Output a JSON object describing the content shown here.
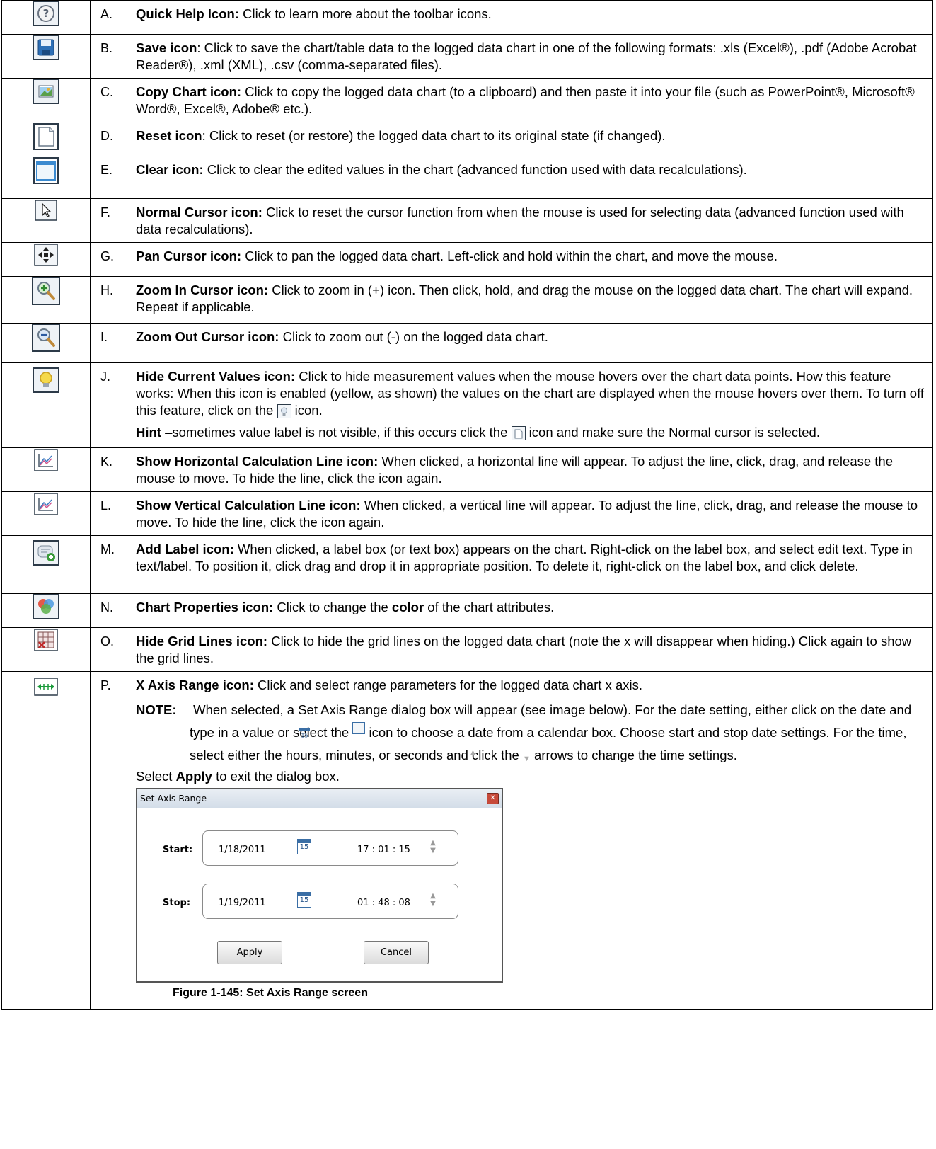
{
  "rows": [
    {
      "letter": "A.",
      "label": "Quick Help Icon:",
      "text": " Click to learn more about the toolbar icons.",
      "icon": "question-circle-icon"
    },
    {
      "letter": "B.",
      "label": "Save icon",
      "text": ": Click to save the chart/table data to the logged data chart in one of the following formats: .xls (Excel®), .pdf (Adobe Acrobat Reader®), .xml (XML), .csv (comma-separated files).",
      "icon": "floppy-save-icon"
    },
    {
      "letter": "C.",
      "label": "Copy Chart icon:",
      "text": " Click to copy the logged data chart (to a clipboard) and then paste it into your file (such as PowerPoint®, Microsoft® Word®, Excel®, Adobe® etc.).",
      "icon": "copy-chart-icon"
    },
    {
      "letter": "D.",
      "label": "Reset icon",
      "text": ": Click to reset (or restore) the logged data chart to its original state (if changed).",
      "icon": "blank-page-icon"
    },
    {
      "letter": "E.",
      "label": "Clear icon:",
      "text": " Click to clear the edited values in the chart (advanced function used with data recalculations).",
      "icon": "clear-window-icon"
    },
    {
      "letter": "F.",
      "label": "Normal Cursor icon:",
      "text": " Click to reset the cursor function from when the mouse is used for selecting data (advanced function used with data recalculations).",
      "icon": "arrow-cursor-icon"
    },
    {
      "letter": "G.",
      "label": "Pan Cursor icon:",
      "text": " Click to pan the logged data chart. Left-click and hold within the chart, and move the mouse.",
      "icon": "pan-arrows-icon"
    },
    {
      "letter": "H.",
      "label": "Zoom In Cursor icon:",
      "text": "  Click to zoom in (+) icon. Then click, hold, and drag the mouse on the logged data chart. The chart will expand. Repeat if applicable.",
      "icon": "zoom-in-icon"
    },
    {
      "letter": "I.",
      "label": "Zoom Out Cursor icon:",
      "text": " Click to zoom out (-) on the logged data chart.",
      "icon": "zoom-out-icon"
    },
    {
      "letter": "J.",
      "label": "Hide Current Values icon:",
      "text": " Click to hide measurement values when the mouse hovers over the chart data points. How this feature works: When this icon is enabled (yellow, as shown) the values on the chart are displayed when the mouse hovers over them. To turn off this feature, click on the",
      "text_after": " icon.",
      "hint_label": "Hint",
      "hint_text": " –sometimes value label is not visible, if this occurs click the",
      "hint_after": " icon and make sure the Normal cursor is selected.",
      "icon": "lightbulb-icon"
    },
    {
      "letter": "K.",
      "label": "Show Horizontal Calculation Line icon:",
      "text": " When clicked, a horizontal line will appear. To adjust the line, click, drag, and release the mouse to move. To hide the line, click the icon again.",
      "icon": "line-chart-icon"
    },
    {
      "letter": "L.",
      "label": "Show Vertical Calculation Line icon:",
      "text": " When clicked, a vertical line will appear. To adjust the line, click, drag, and release the mouse to move. To hide the line, click the icon again.",
      "icon": "line-chart-icon"
    },
    {
      "letter": "M.",
      "label": "Add Label icon:",
      "text": " When clicked, a label box (or text box) appears on the chart. Right-click on the label box, and select edit text. Type in text/label. To position it, click drag and drop it in appropriate position. To delete it, right-click on the label box, and click delete.",
      "icon": "add-label-icon"
    },
    {
      "letter": "N.",
      "label": "Chart Properties icon:",
      "text_before": " Click to change the ",
      "bold_word": "color",
      "text": " of the chart attributes.",
      "icon": "color-circles-icon"
    },
    {
      "letter": "O.",
      "label": "Hide Grid Lines icon:",
      "text": " Click to hide the grid lines on the logged data chart (note the x will disappear when hiding.) Click again to show the grid lines.",
      "icon": "grid-lines-icon"
    },
    {
      "letter": "P.",
      "label": "X Axis Range icon:",
      "text": " Click and select range parameters for the logged data chart x axis.",
      "note_label": "NOTE:",
      "note_text1": " When selected, a Set Axis Range dialog box will appear (see image below). For the date setting, either click on the date and type in a value or select the",
      "note_text2": " icon to choose a date from a calendar box. Choose start and stop date settings. For the time, select either the hours, minutes, or seconds and click the",
      "note_text3": " arrows to change the time settings.",
      "apply_pre": "Select ",
      "apply_bold": "Apply",
      "apply_post": " to exit the dialog box.",
      "icon": "horizontal-range-icon"
    }
  ],
  "dialog": {
    "title": "Set Axis Range",
    "start_label": "Start:",
    "start_date": "1/18/2011",
    "start_time": "17 : 01 : 15",
    "stop_label": "Stop:",
    "stop_date": "1/19/2011",
    "stop_time": "01 : 48 : 08",
    "calendar_num": "15",
    "apply": "Apply",
    "cancel": "Cancel"
  },
  "caption": "Figure 1-145: Set Axis Range screen"
}
